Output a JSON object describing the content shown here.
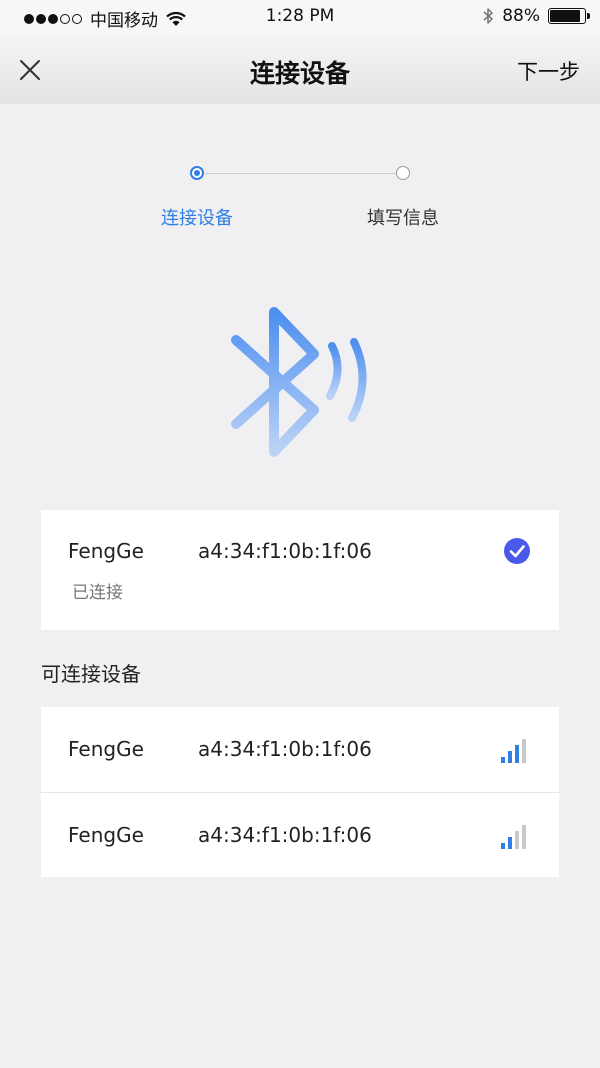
{
  "status_bar": {
    "carrier": "中国移动",
    "time": "1:28 PM",
    "battery": "88%",
    "battery_level": 0.88,
    "signal_dots_filled": 3,
    "signal_dots_total": 5
  },
  "nav": {
    "title": "连接设备",
    "next_label": "下一步",
    "close_icon": "close-icon"
  },
  "stepper": {
    "steps": [
      {
        "label": "连接设备",
        "active": true
      },
      {
        "label": "填写信息",
        "active": false
      }
    ]
  },
  "connected": {
    "name": "FengGe",
    "mac": "a4:34:f1:0b:1f:06",
    "status": "已连接",
    "icon": "check-circle-icon"
  },
  "available": {
    "title": "可连接设备",
    "devices": [
      {
        "name": "FengGe",
        "mac": "a4:34:f1:0b:1f:06",
        "signal_bars": 3,
        "signal_total": 4
      },
      {
        "name": "FengGe",
        "mac": "a4:34:f1:0b:1f:06",
        "signal_bars": 2,
        "signal_total": 4
      }
    ]
  },
  "colors": {
    "accent": "#2f7fe6",
    "check": "#4a5ae8",
    "background": "#f0f0f3",
    "signal_off": "#c8c8c8"
  }
}
